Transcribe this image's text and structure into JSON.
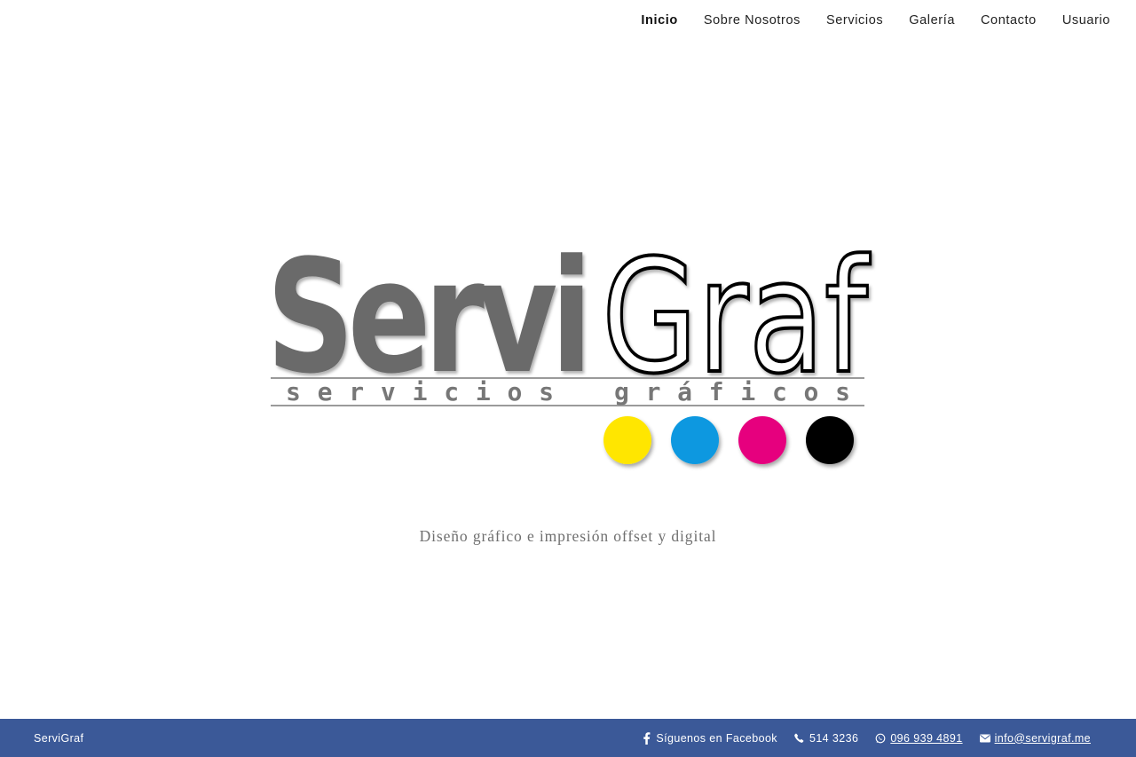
{
  "nav": {
    "items": [
      {
        "label": "Inicio",
        "active": true
      },
      {
        "label": "Sobre Nosotros",
        "active": false
      },
      {
        "label": "Servicios",
        "active": false
      },
      {
        "label": "Galería",
        "active": false
      },
      {
        "label": "Contacto",
        "active": false
      },
      {
        "label": "Usuario",
        "active": false
      }
    ]
  },
  "logo": {
    "word_primary": "Servi",
    "word_secondary": "Graf",
    "subtitle_left": "servicios",
    "subtitle_right": "gráficos",
    "ink_dots": [
      {
        "name": "yellow",
        "color": "#ffe600"
      },
      {
        "name": "cyan",
        "color": "#0898e0"
      },
      {
        "name": "magenta",
        "color": "#e6007e"
      },
      {
        "name": "black",
        "color": "#000000"
      }
    ],
    "colors": {
      "primary_text": "#6b6b6b",
      "secondary_text": "#000000",
      "rule": "#9a9a9a"
    }
  },
  "tagline": "Diseño gráfico e impresión offset y digital",
  "footer": {
    "brand": "ServiGraf",
    "background": "#3b5998",
    "facebook": {
      "icon": "facebook-icon",
      "label": "Síguenos en Facebook"
    },
    "phone": {
      "icon": "phone-icon",
      "label": "514 3236"
    },
    "whatsapp": {
      "icon": "whatsapp-icon",
      "label": "096 939 4891"
    },
    "email": {
      "icon": "envelope-icon",
      "label": "info@servigraf.me"
    }
  }
}
